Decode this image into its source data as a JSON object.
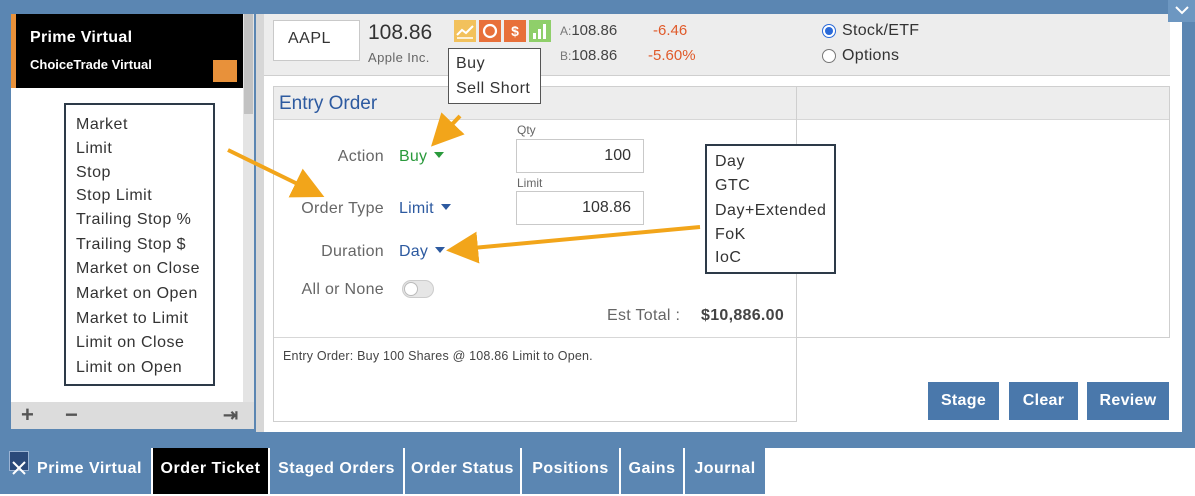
{
  "account": {
    "name": "Prime Virtual",
    "subtitle": "ChoiceTrade Virtual"
  },
  "left_footer": {
    "add_icon": "+",
    "remove_icon": "−",
    "logout_icon": "⇥"
  },
  "order_type_menu": [
    "Market",
    "Limit",
    "Stop",
    "Stop Limit",
    "Trailing Stop %",
    "Trailing Stop $",
    "Market on Close",
    "Market on Open",
    "Market to Limit",
    "Limit on Close",
    "Limit on Open"
  ],
  "quote": {
    "symbol": "AAPL",
    "price": "108.86",
    "company": "Apple Inc.",
    "ask_label": "A:",
    "ask": "108.86",
    "change": "-6.46",
    "bid_label": "B:",
    "bid": "108.86",
    "change_pct": "-5.60%",
    "icons": [
      "chart-icon",
      "circle-icon",
      "dollar-icon",
      "bars-icon"
    ]
  },
  "security_type": {
    "options": [
      "Stock/ETF",
      "Options"
    ],
    "selected": "Stock/ETF"
  },
  "action_menu": [
    "Buy",
    "Sell Short"
  ],
  "entry": {
    "title": "Entry Order",
    "action_label": "Action",
    "action_value": "Buy",
    "qty_label": "Qty",
    "qty_value": "100",
    "order_type_label": "Order Type",
    "order_type_value": "Limit",
    "limit_label": "Limit",
    "limit_value": "108.86",
    "duration_label": "Duration",
    "duration_value": "Day",
    "aon_label": "All or None",
    "est_label": "Est Total :",
    "est_value": "$10,886.00",
    "summary": "Entry Order:  Buy  100 Shares @ 108.86 Limit to Open."
  },
  "duration_menu": [
    "Day",
    "GTC",
    "Day+Extended",
    "FoK",
    "IoC"
  ],
  "buttons": {
    "stage": "Stage",
    "clear": "Clear",
    "review": "Review"
  },
  "tabs": [
    "Prime Virtual",
    "Order Ticket",
    "Staged Orders",
    "Order Status",
    "Positions",
    "Gains",
    "Journal"
  ],
  "active_tab": "Order Ticket",
  "colors": {
    "accent_blue": "#2d5aa0",
    "orange": "#e8913a",
    "green": "#2a9a3c",
    "negative": "#e05a2a",
    "arrow": "#f2a51a",
    "frame": "#5b86b2"
  }
}
